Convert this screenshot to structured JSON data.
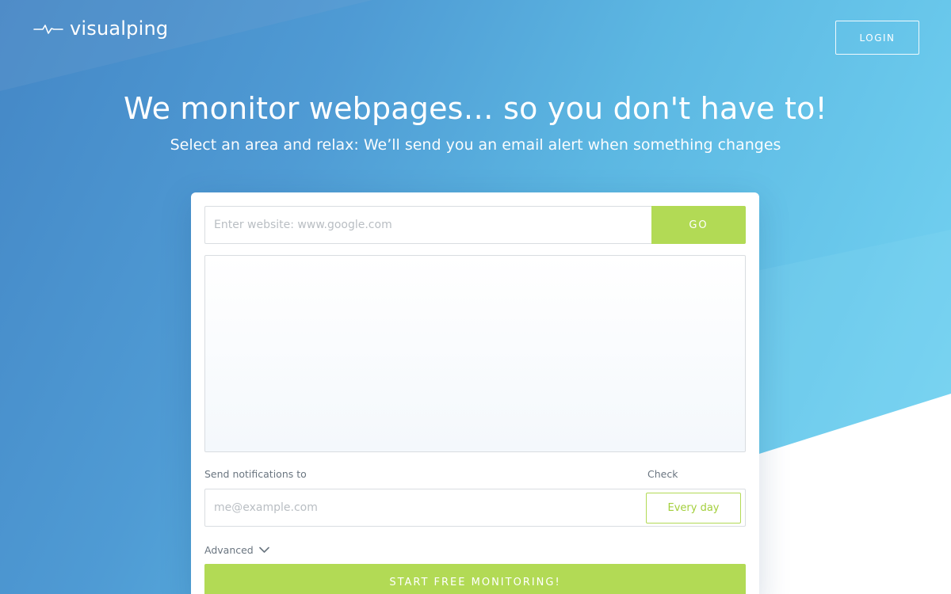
{
  "brand": {
    "name": "visualping"
  },
  "header": {
    "login_label": "LOGIN"
  },
  "hero": {
    "title": "We monitor webpages… so you don't have to!",
    "subtitle": "Select an area and relax: We’ll send you an email alert when something changes"
  },
  "form": {
    "url_placeholder": "Enter website: www.google.com",
    "url_value": "",
    "go_label": "GO",
    "notify_label": "Send notifications to",
    "email_placeholder": "me@example.com",
    "email_value": "",
    "check_label": "Check",
    "frequency_value": "Every day",
    "advanced_label": "Advanced",
    "start_label": "START FREE MONITORING!"
  },
  "colors": {
    "accent_green": "#b2da55",
    "background_blue": "#4f9bd4",
    "light_blue": "#79d6f3"
  },
  "icons": {
    "logo": "pulse-icon",
    "advanced": "chevron-down-icon"
  }
}
